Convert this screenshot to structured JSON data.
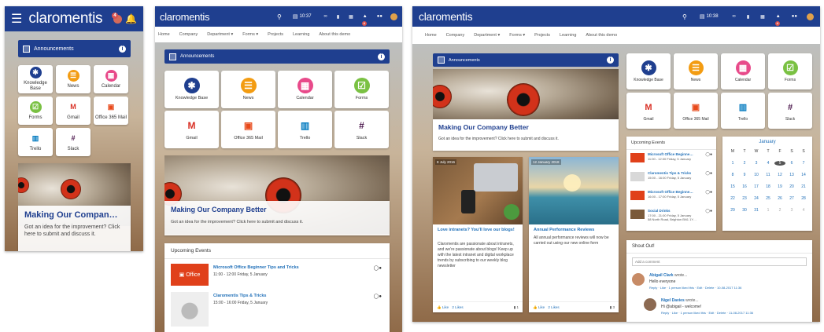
{
  "brand": {
    "name": "claromentis"
  },
  "topbar": {
    "time_tablet": "10:37",
    "time_desktop": "10:38",
    "notif_count": "4"
  },
  "nav": [
    "Home",
    "Company",
    "Department ▾",
    "Forms ▾",
    "Projects",
    "Learning",
    "About this demo"
  ],
  "announcements": {
    "title": "Announcements",
    "info": "i"
  },
  "apps": [
    {
      "label": "Knowledge Base",
      "icon": "lightbulb-icon",
      "color": "#1f3f8f"
    },
    {
      "label": "News",
      "icon": "newspaper-icon",
      "color": "#f39c12"
    },
    {
      "label": "Calendar",
      "icon": "calendar-icon",
      "color": "#e84a8a"
    },
    {
      "label": "Forms",
      "icon": "forms-icon",
      "color": "#7ac143"
    },
    {
      "label": "Gmail",
      "icon": "gmail-icon",
      "color": "#d93025"
    },
    {
      "label": "Office 365 Mail",
      "icon": "office365-icon",
      "color": "#e84a1b"
    },
    {
      "label": "Trello",
      "icon": "trello-icon",
      "color": "#0079bf"
    },
    {
      "label": "Slack",
      "icon": "slack-icon",
      "color": "#4a154b"
    }
  ],
  "hero": {
    "title_short": "Making Our Compan…",
    "title": "Making Our Company Better",
    "text": "Got an idea for the improvement? Click here to submit and discuss it."
  },
  "events": {
    "title": "Upcoming Events",
    "items": [
      {
        "title": "Microsoft Office Beginner Tips and Tricks",
        "title_short": "Microsoft Office Beginne…",
        "time": "11:00 - 12:00 Friday, 5 January",
        "thumb": "Office"
      },
      {
        "title": "Claromentis Tips & Tricks",
        "time": "15:00 - 16:00 Friday, 5 January",
        "thumb": ""
      },
      {
        "title": "Microsoft Office Beginne…",
        "time": "16:00 - 17:00 Friday, 5 January",
        "thumb": ""
      },
      {
        "title": "Social Drinks",
        "time": "17:00 - 21:00 Friday, 5 January",
        "loc": "58 North Road, Brighton BN1 1Y…",
        "thumb": ""
      }
    ]
  },
  "calendar": {
    "month": "January",
    "days": [
      "M",
      "T",
      "W",
      "T",
      "F",
      "S",
      "S"
    ],
    "weeks": [
      [
        "1",
        "2",
        "3",
        "4",
        "5",
        "6",
        "7"
      ],
      [
        "8",
        "9",
        "10",
        "11",
        "12",
        "13",
        "14"
      ],
      [
        "15",
        "16",
        "17",
        "18",
        "19",
        "20",
        "21"
      ],
      [
        "22",
        "23",
        "24",
        "25",
        "26",
        "27",
        "28"
      ],
      [
        "29",
        "30",
        "31",
        "1",
        "2",
        "3",
        "4"
      ]
    ]
  },
  "news": [
    {
      "date": "8 July 2016",
      "title": "Love intranets? You'll love our blogs!",
      "text": "Claromentis are passionate about intranets, and we're passionate about blogs! Keep up with the latest intranet and digital workplace trends by subscribing to our weekly blog newsletter",
      "likes": "2 Likes",
      "like": "Like",
      "comments": "1"
    },
    {
      "date": "12 January 2018",
      "title": "Annual Performance Reviews",
      "text": "All annual performance reviews will now be carried out using our new online form",
      "likes": "2 Likes",
      "like": "Like",
      "comments": "3"
    }
  ],
  "shoutout": {
    "title": "Shout Out!",
    "placeholder": "Add a comment",
    "posts": [
      {
        "name": "Abigail Clark",
        "verb": "wrote...",
        "text": "Hello everyone",
        "meta": "Reply · Like · 1 person liked this · Edit · Delete · 10-08-2017 11:36"
      },
      {
        "name": "Nigel Davies",
        "verb": "wrote...",
        "text": "Hi @abigail - welcome!",
        "meta": "Reply · Like · 1 person liked this · Edit · Delete · 11-08-2017 11:36"
      }
    ]
  }
}
